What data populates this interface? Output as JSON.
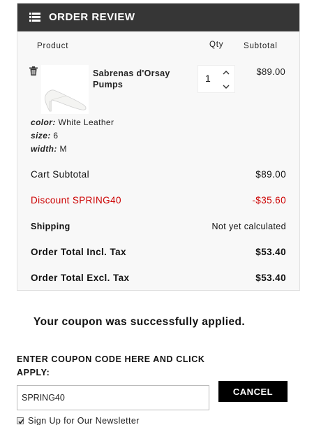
{
  "review": {
    "title": "ORDER REVIEW",
    "columns": {
      "product": "Product",
      "qty": "Qty",
      "subtotal": "Subtotal"
    },
    "item": {
      "name": "Sabrenas d'Orsay Pumps",
      "qty": "1",
      "subtotal": "$89.00",
      "attributes": [
        {
          "key": "color:",
          "value": "White Leather"
        },
        {
          "key": "size:",
          "value": "6"
        },
        {
          "key": "width:",
          "value": "M"
        }
      ]
    },
    "summary": {
      "cart_subtotal_label": "Cart Subtotal",
      "cart_subtotal_value": "$89.00",
      "discount_label": "Discount SPRING40",
      "discount_value": "-$35.60",
      "shipping_label": "Shipping",
      "shipping_value": "Not yet calculated",
      "total_incl_label": "Order Total Incl. Tax",
      "total_incl_value": "$53.40",
      "total_excl_label": "Order Total Excl. Tax",
      "total_excl_value": "$53.40"
    }
  },
  "coupon": {
    "success_message": "Your coupon was successfully applied.",
    "label": "ENTER COUPON CODE HERE AND CLICK APPLY:",
    "input_value": "SPRING40",
    "cancel_label": "CANCEL"
  },
  "newsletter": {
    "label": "Sign Up for Our Newsletter",
    "checked": true
  },
  "icons": {
    "header": "list-icon",
    "remove": "trash-icon",
    "qty_up": "chevron-up-icon",
    "qty_down": "chevron-down-icon",
    "checkbox": "check-icon"
  },
  "colors": {
    "header_bg": "#363636",
    "discount": "#cc0000",
    "button_bg": "#000000"
  }
}
